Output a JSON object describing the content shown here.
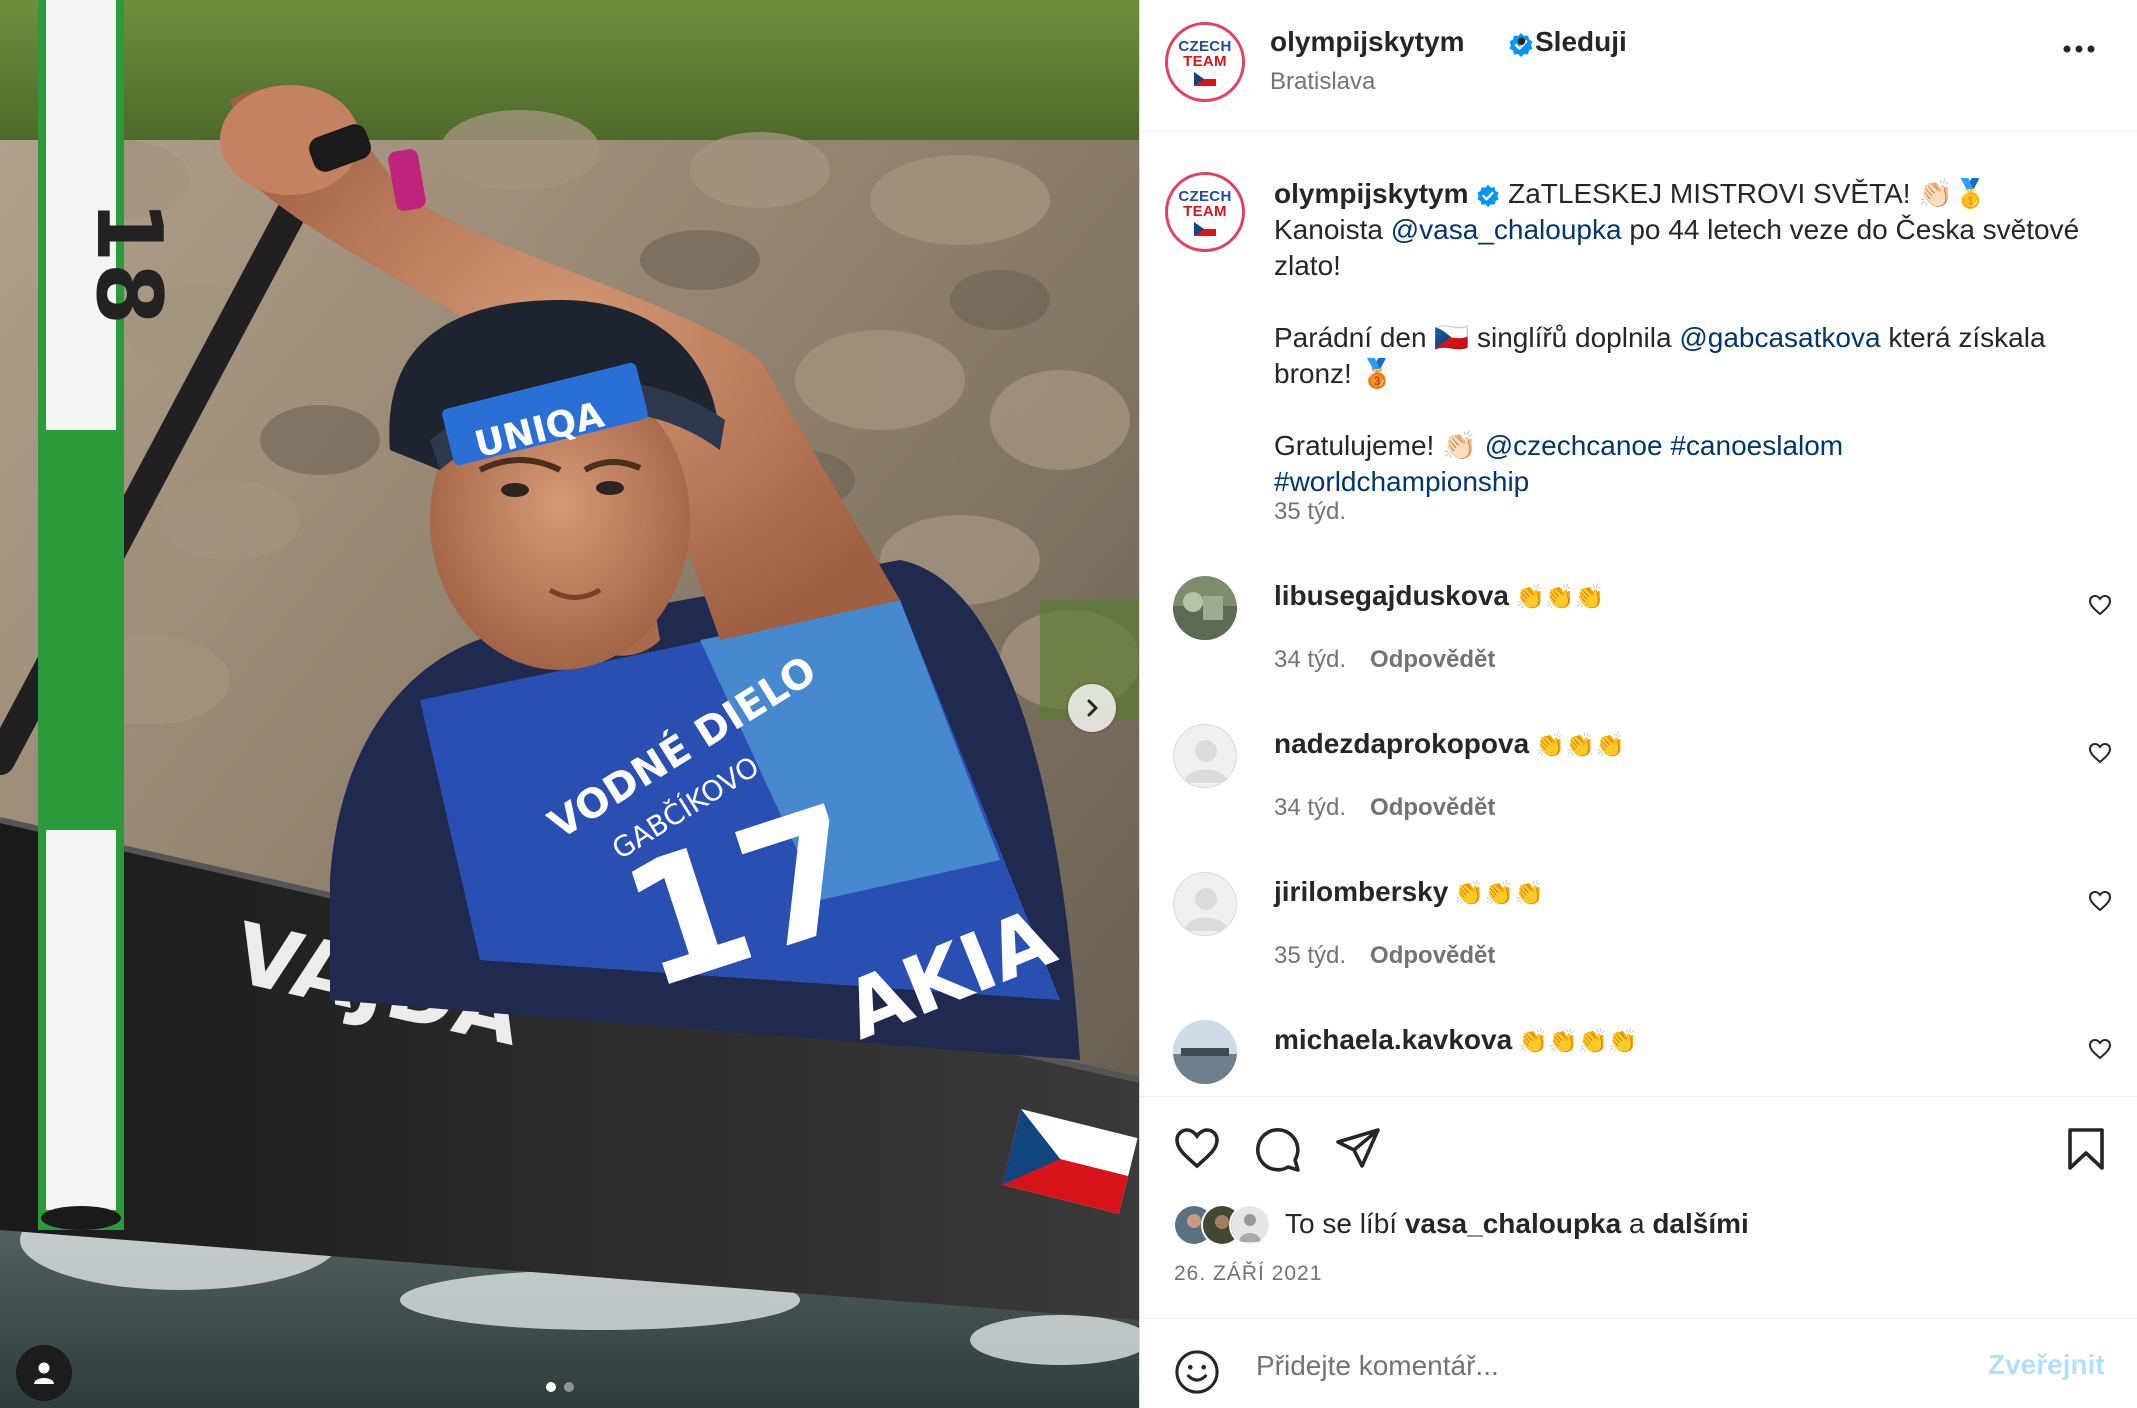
{
  "account": {
    "username": "olympijskytym",
    "follow_label": "Sleduji",
    "location": "Bratislava",
    "logo_line1": "CZECH",
    "logo_line2": "TEAM"
  },
  "photo": {
    "gate_numbers": "18",
    "helmet_text": "UNIQA",
    "bib_number": "17",
    "bib_text_1": "VODNÉ DIELO",
    "bib_text_2": "GABČÍKOVO",
    "bib_country": "AKIA",
    "boat_text": "VAJDA",
    "carousel_index": 1,
    "carousel_count": 2
  },
  "caption": {
    "username": "olympijskytym",
    "p1_text": "ZaTLESKEJ MISTROVI SVĚTA! 👏🏻🥇 Kanoista",
    "p1_mention": "@vasa_chaloupka",
    "p1_rest": "po 44 letech veze do Česka světové zlato!",
    "p2_text_a": "Parádní den 🇨🇿 singlířů doplnila",
    "p2_mention": "@gabcasatkova",
    "p2_text_b": "která získala bronz! 🥉",
    "p3_text": "Gratulujeme! 👏🏻",
    "p3_mention": "@czechcanoe",
    "p3_tag1": "#canoeslalom",
    "p3_tag2": "#worldchampionship",
    "time": "35 týd."
  },
  "comments": [
    {
      "username": "libusegajduskova",
      "text": "👏👏👏",
      "time": "34 týd.",
      "reply": "Odpovědět"
    },
    {
      "username": "nadezdaprokopova",
      "text": "👏👏👏",
      "time": "34 týd.",
      "reply": "Odpovědět"
    },
    {
      "username": "jirilombersky",
      "text": "👏👏👏",
      "time": "35 týd.",
      "reply": "Odpovědět"
    },
    {
      "username": "michaela.kavkova",
      "text": "👏👏👏👏",
      "time": "",
      "reply": ""
    }
  ],
  "likes": {
    "prefix": "To se líbí",
    "user": "vasa_chaloupka",
    "conj": "a",
    "others": "dalšími"
  },
  "post_date": "26. ZÁŘÍ 2021",
  "add_comment": {
    "placeholder": "Přidejte komentář...",
    "post_label": "Zveřejnit"
  },
  "icons": {
    "verified": "verified-badge-icon",
    "more": "more-options-icon",
    "like": "heart-icon",
    "comment": "comment-bubble-icon",
    "share": "paper-plane-icon",
    "save": "bookmark-icon",
    "emoji": "emoji-smiley-icon",
    "next": "chevron-right-icon",
    "tagged": "person-icon"
  },
  "colors": {
    "link": "#00376b",
    "verified": "#0095f6",
    "post_disabled": "#b2dffc",
    "muted": "#737373"
  }
}
